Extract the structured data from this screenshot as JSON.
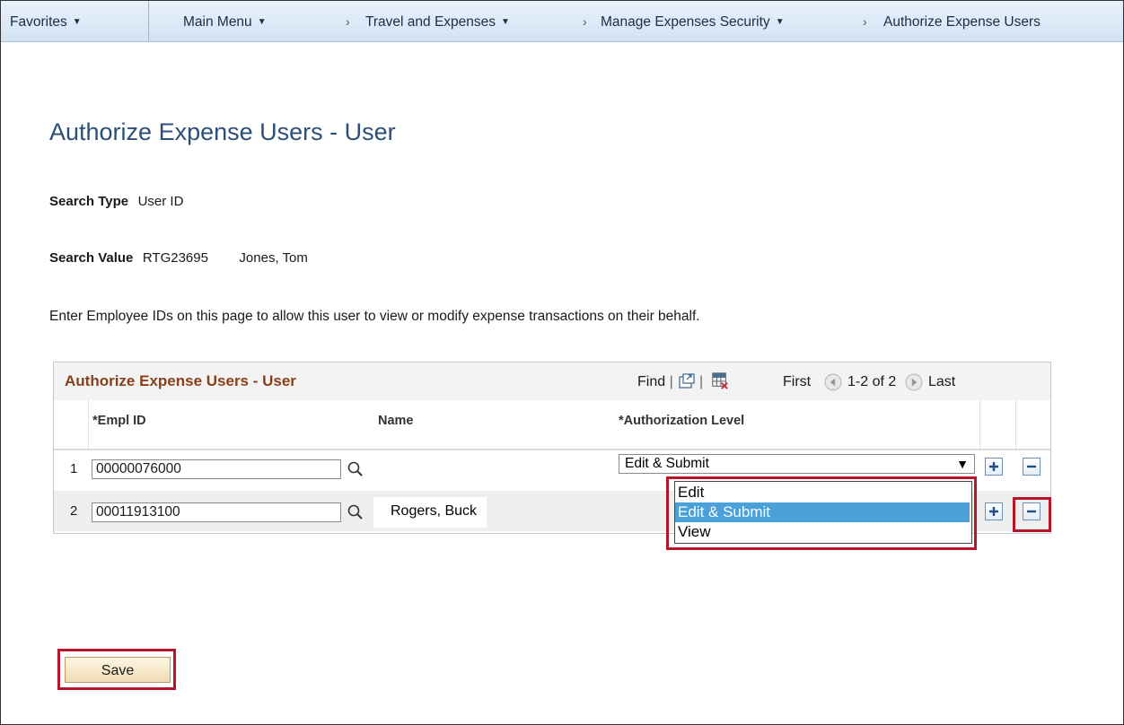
{
  "navbar": {
    "favorites": "Favorites",
    "main_menu": "Main Menu",
    "crumb_travel": "Travel and Expenses",
    "crumb_security": "Manage Expenses Security",
    "crumb_current": "Authorize Expense Users"
  },
  "page": {
    "title": "Authorize Expense Users - User",
    "search_type_label": "Search Type",
    "search_type_value": "User ID",
    "search_value_label": "Search Value",
    "search_value_id": "RTG23695",
    "search_value_name": "Jones, Tom",
    "description": "Enter Employee IDs on this page to allow this user to view or modify expense transactions on their behalf."
  },
  "grid": {
    "title": "Authorize Expense Users - User",
    "find_label": "Find",
    "first_label": "First",
    "count_label": "1-2 of 2",
    "last_label": "Last",
    "columns": {
      "empl_id": "*Empl ID",
      "name": "Name",
      "auth_level": "*Authorization Level"
    },
    "rows": [
      {
        "num": "1",
        "empl_id": "00000076000",
        "name": "",
        "auth_level": "Edit & Submit"
      },
      {
        "num": "2",
        "empl_id": "00011913100",
        "name": "Rogers, Buck",
        "auth_level": ""
      }
    ]
  },
  "dropdown": {
    "options": [
      "Edit",
      "Edit & Submit",
      "View"
    ],
    "selected": "Edit & Submit"
  },
  "buttons": {
    "save": "Save"
  },
  "colors": {
    "title_blue": "#2c4f7a",
    "grid_title": "#8a3f1a",
    "highlight_red": "#b5162b",
    "selected_option": "#4aa0d8"
  }
}
